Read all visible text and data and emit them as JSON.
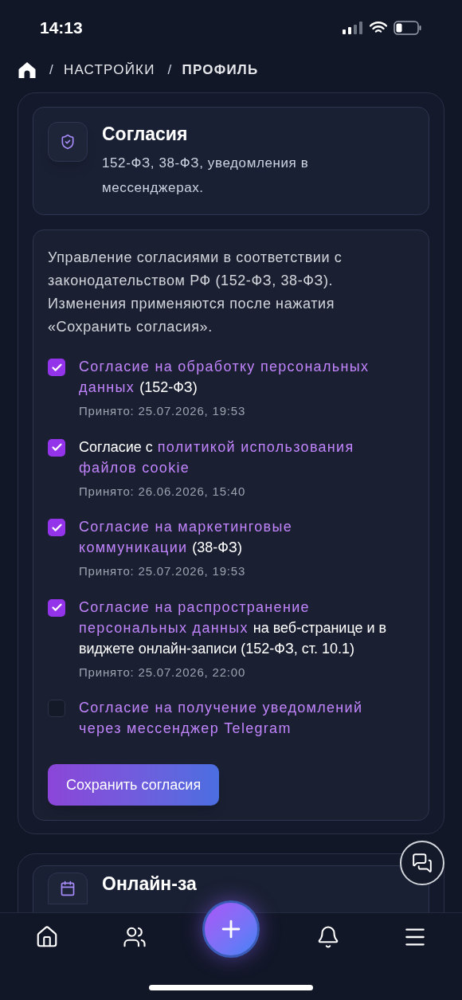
{
  "status_bar": {
    "time": "14:13"
  },
  "breadcrumb": [
    {
      "label": "НАСТРОЙКИ",
      "current": false
    },
    {
      "label": "ПРОФИЛЬ",
      "current": true
    }
  ],
  "separator": "/",
  "section": {
    "title": "Согласия",
    "subtitle": "152-ФЗ, 38-ФЗ, уведомления в мессенджерах."
  },
  "intro": "Управление согласиями в соответствии с законодательством РФ (152-ФЗ, 38-ФЗ). Изменения применяются после нажатия «Сохранить согласия».",
  "consents": [
    {
      "checked": true,
      "lines": [
        [
          {
            "text": "Согласие на обработку персональных",
            "link": true
          }
        ],
        [
          {
            "text": "данных",
            "link": true
          },
          {
            "text": "(152-ФЗ)",
            "link": false
          }
        ]
      ],
      "accepted": "Принято: 25.07.2026, 19:53"
    },
    {
      "checked": true,
      "lines": [
        [
          {
            "text": "Согласие с",
            "link": false
          },
          {
            "text": "политикой использования",
            "link": true
          }
        ],
        [
          {
            "text": "файлов cookie",
            "link": true
          }
        ]
      ],
      "accepted": "Принято: 26.06.2026, 15:40"
    },
    {
      "checked": true,
      "lines": [
        [
          {
            "text": "Согласие на маркетинговые",
            "link": true
          }
        ],
        [
          {
            "text": "коммуникации",
            "link": true
          },
          {
            "text": "(38-ФЗ)",
            "link": false
          }
        ]
      ],
      "accepted": "Принято: 25.07.2026, 19:53"
    },
    {
      "checked": true,
      "lines": [
        [
          {
            "text": "Согласие на распространение",
            "link": true
          }
        ],
        [
          {
            "text": "персональных данных",
            "link": true
          },
          {
            "text": "на веб-странице и в",
            "link": false
          }
        ],
        [
          {
            "text": "виджете онлайн-записи (152-ФЗ, ст. 10.1)",
            "link": false
          }
        ]
      ],
      "accepted": "Принято: 25.07.2026, 22:00"
    },
    {
      "checked": false,
      "lines": [
        [
          {
            "text": "Согласие на получение уведомлений",
            "link": true
          }
        ],
        [
          {
            "text": "через мессенджер Telegram",
            "link": true
          }
        ]
      ]
    }
  ],
  "save_button": "Сохранить согласия",
  "next_section": {
    "title": "Онлайн-за"
  },
  "bottom_nav": [
    {
      "kind": "home"
    },
    {
      "kind": "clients"
    },
    {
      "kind": "add"
    },
    {
      "kind": "bell"
    },
    {
      "kind": "menu"
    }
  ]
}
